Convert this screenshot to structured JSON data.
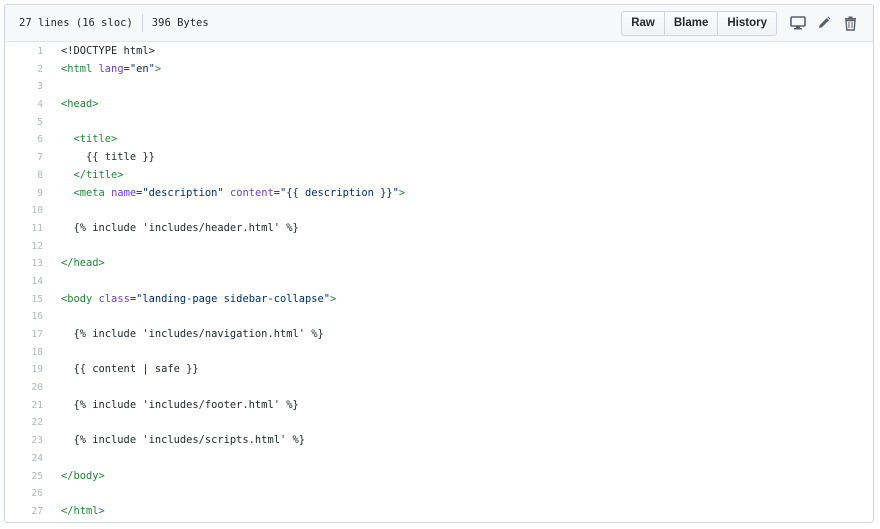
{
  "file_header": {
    "lines_info": "27 lines (16 sloc)",
    "size_info": "396 Bytes",
    "buttons": [
      "Raw",
      "Blame",
      "History"
    ],
    "icons": [
      "desktop-icon",
      "pencil-icon",
      "trash-icon"
    ]
  },
  "colors": {
    "tag": "#22863a",
    "attr": "#6f42c1",
    "string": "#032f62",
    "line_number": "#b3b7bb"
  },
  "code_lines": [
    [
      {
        "t": "<!DOCTYPE html>",
        "c": "plain"
      }
    ],
    [
      {
        "t": "<html",
        "c": "tag"
      },
      {
        "t": " ",
        "c": "plain"
      },
      {
        "t": "lang",
        "c": "attr"
      },
      {
        "t": "=",
        "c": "plain"
      },
      {
        "t": "\"en\"",
        "c": "str"
      },
      {
        "t": ">",
        "c": "tag"
      }
    ],
    [],
    [
      {
        "t": "<head>",
        "c": "tag"
      }
    ],
    [],
    [
      {
        "t": "  ",
        "c": "plain"
      },
      {
        "t": "<title>",
        "c": "tag"
      }
    ],
    [
      {
        "t": "    {{ title }}",
        "c": "plain"
      }
    ],
    [
      {
        "t": "  ",
        "c": "plain"
      },
      {
        "t": "</title>",
        "c": "tag"
      }
    ],
    [
      {
        "t": "  ",
        "c": "plain"
      },
      {
        "t": "<meta",
        "c": "tag"
      },
      {
        "t": " ",
        "c": "plain"
      },
      {
        "t": "name",
        "c": "attr"
      },
      {
        "t": "=",
        "c": "plain"
      },
      {
        "t": "\"description\"",
        "c": "str"
      },
      {
        "t": " ",
        "c": "plain"
      },
      {
        "t": "content",
        "c": "attr"
      },
      {
        "t": "=",
        "c": "plain"
      },
      {
        "t": "\"{{ description }}\"",
        "c": "str"
      },
      {
        "t": ">",
        "c": "tag"
      }
    ],
    [],
    [
      {
        "t": "  {% include 'includes/header.html' %}",
        "c": "plain"
      }
    ],
    [],
    [
      {
        "t": "</head>",
        "c": "tag"
      }
    ],
    [],
    [
      {
        "t": "<body",
        "c": "tag"
      },
      {
        "t": " ",
        "c": "plain"
      },
      {
        "t": "class",
        "c": "attr"
      },
      {
        "t": "=",
        "c": "plain"
      },
      {
        "t": "\"landing-page sidebar-collapse\"",
        "c": "str"
      },
      {
        "t": ">",
        "c": "tag"
      }
    ],
    [],
    [
      {
        "t": "  {% include 'includes/navigation.html' %}",
        "c": "plain"
      }
    ],
    [],
    [
      {
        "t": "  {{ content | safe }}",
        "c": "plain"
      }
    ],
    [],
    [
      {
        "t": "  {% include 'includes/footer.html' %}",
        "c": "plain"
      }
    ],
    [],
    [
      {
        "t": "  {% include 'includes/scripts.html' %}",
        "c": "plain"
      }
    ],
    [],
    [
      {
        "t": "</body>",
        "c": "tag"
      }
    ],
    [],
    [
      {
        "t": "</html>",
        "c": "tag"
      }
    ]
  ]
}
